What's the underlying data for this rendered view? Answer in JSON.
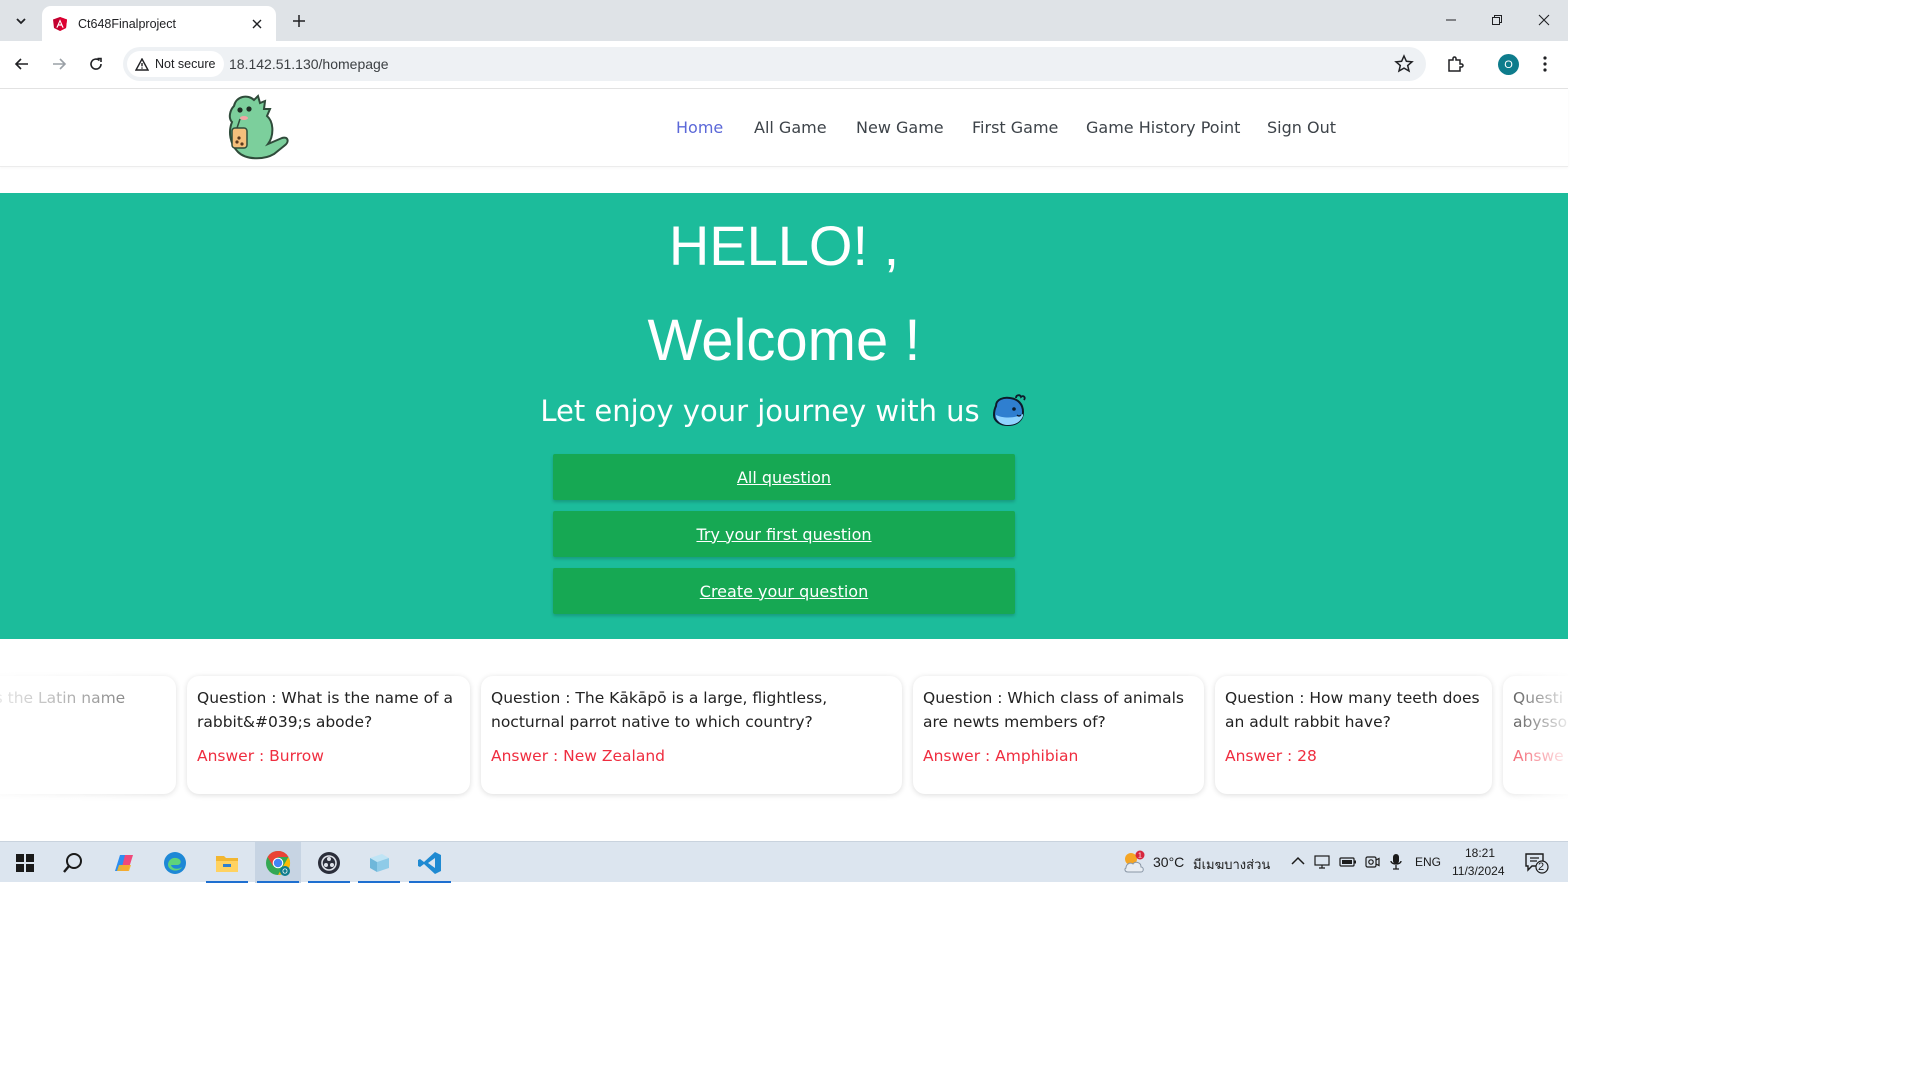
{
  "browser": {
    "tab_title": "Ct648Finalproject",
    "security_label": "Not secure",
    "url": "18.142.51.130/homepage",
    "profile_initial": "O"
  },
  "nav": {
    "items": [
      {
        "label": "Home",
        "active": true
      },
      {
        "label": "All Game",
        "active": false
      },
      {
        "label": "New Game",
        "active": false
      },
      {
        "label": "First Game",
        "active": false
      },
      {
        "label": "Game History Point",
        "active": false
      },
      {
        "label": "Sign Out",
        "active": false
      }
    ]
  },
  "hero": {
    "hello": "HELLO! ,",
    "welcome": "Welcome !",
    "subtitle": "Let enjoy your journey with us",
    "buttons": [
      "All question",
      "Try your first question",
      "Create your question"
    ]
  },
  "cards": [
    {
      "question": "ous is the Latin name\nture?",
      "answer": ""
    },
    {
      "question": "Question : What is the name of a rabbit&#039;s abode?",
      "answer": "Answer : Burrow"
    },
    {
      "question": "Question : The Kākāpō is a large, flightless, nocturnal parrot native to which country?",
      "answer": "Answer : New Zealand"
    },
    {
      "question": "Question : Which class of animals are newts members of?",
      "answer": "Answer : Amphibian"
    },
    {
      "question": "Question : How many teeth does an adult rabbit have?",
      "answer": "Answer : 28"
    },
    {
      "question": "Questi\nabysso",
      "answer": "Answe"
    }
  ],
  "taskbar": {
    "weather": "30°C",
    "weather_desc": "มีเมฆบางส่วน",
    "language": "ENG",
    "time": "18:21",
    "date": "11/3/2024",
    "notifications": "2"
  },
  "colors": {
    "hero_bg": "#1cbc9b",
    "button_bg": "#16a853",
    "nav_active": "#5b68d8",
    "answer": "#ef2d3f"
  }
}
